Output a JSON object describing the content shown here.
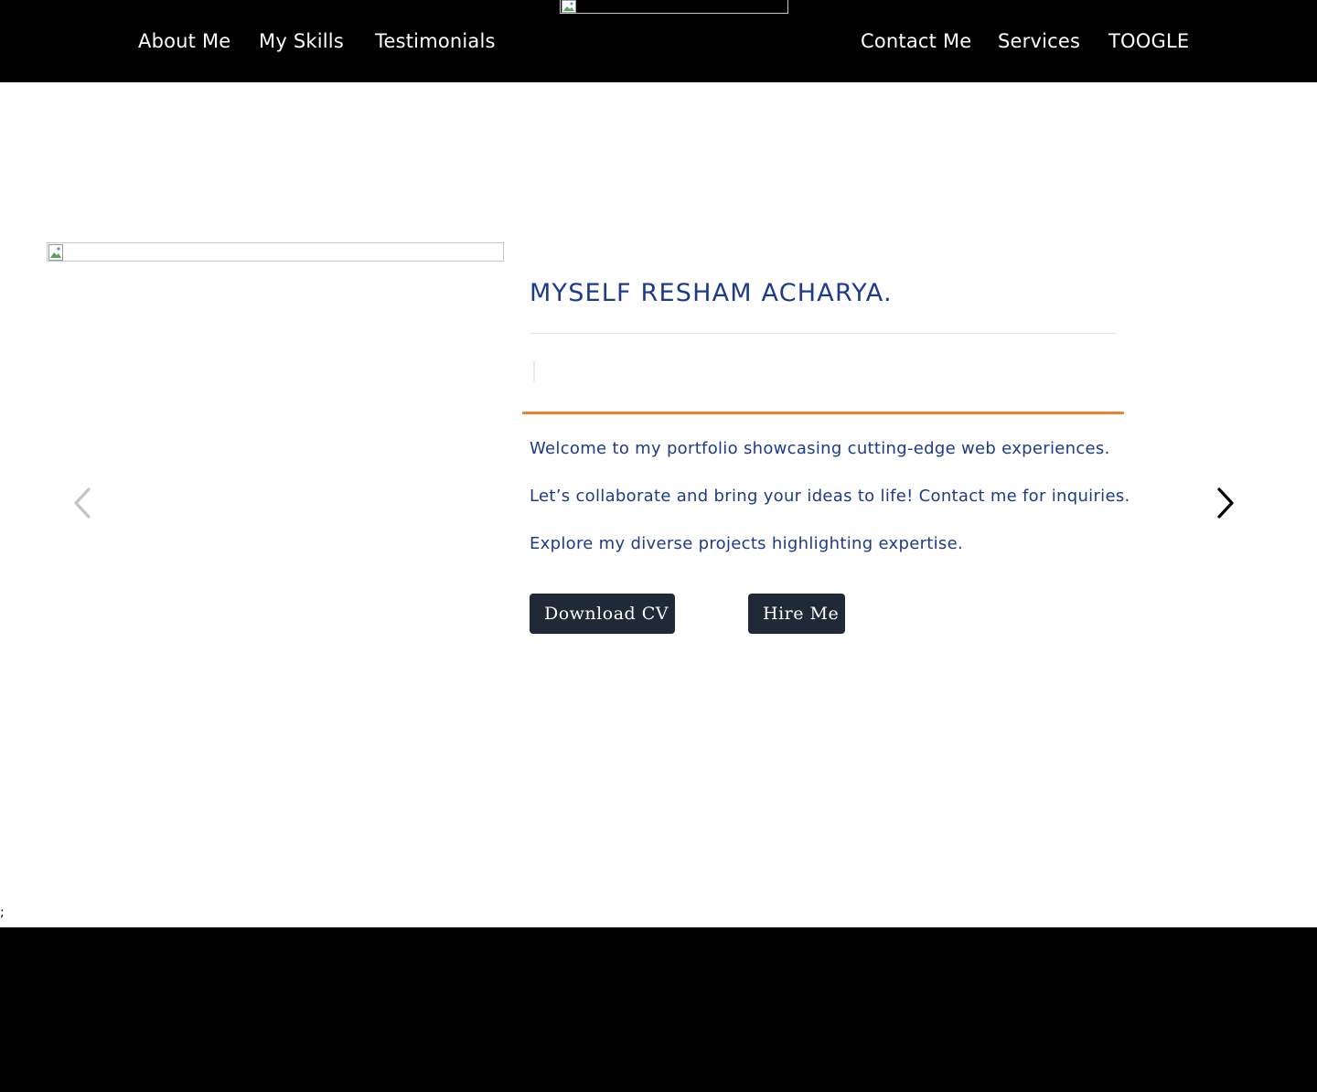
{
  "nav": {
    "left_items": [
      "About Me",
      "My Skills",
      "Testimonials"
    ],
    "right_items": [
      "Contact Me",
      "Services",
      "TOOGLE"
    ],
    "logo_icon": "broken-image-icon"
  },
  "hero": {
    "profile_image_icon": "broken-image-icon",
    "title": "MYSELF RESHAM ACHARYA.",
    "lines": [
      "Welcome to my portfolio showcasing cutting-edge web experiences.",
      "Let’s collaborate and bring your ideas to life! Contact me for inquiries.",
      "Explore my diverse projects highlighting expertise."
    ],
    "buttons": {
      "download_cv": "Download CV",
      "hire_me": "Hire Me"
    },
    "carousel": {
      "prev_icon": "chevron-left-icon",
      "next_icon": "chevron-right-icon"
    }
  },
  "stray_text": ";",
  "colors": {
    "nav_bg": "#000000",
    "accent_blue": "#1e3a8a",
    "accent_orange": "#f07f2e",
    "button_bg": "#1f2937"
  }
}
